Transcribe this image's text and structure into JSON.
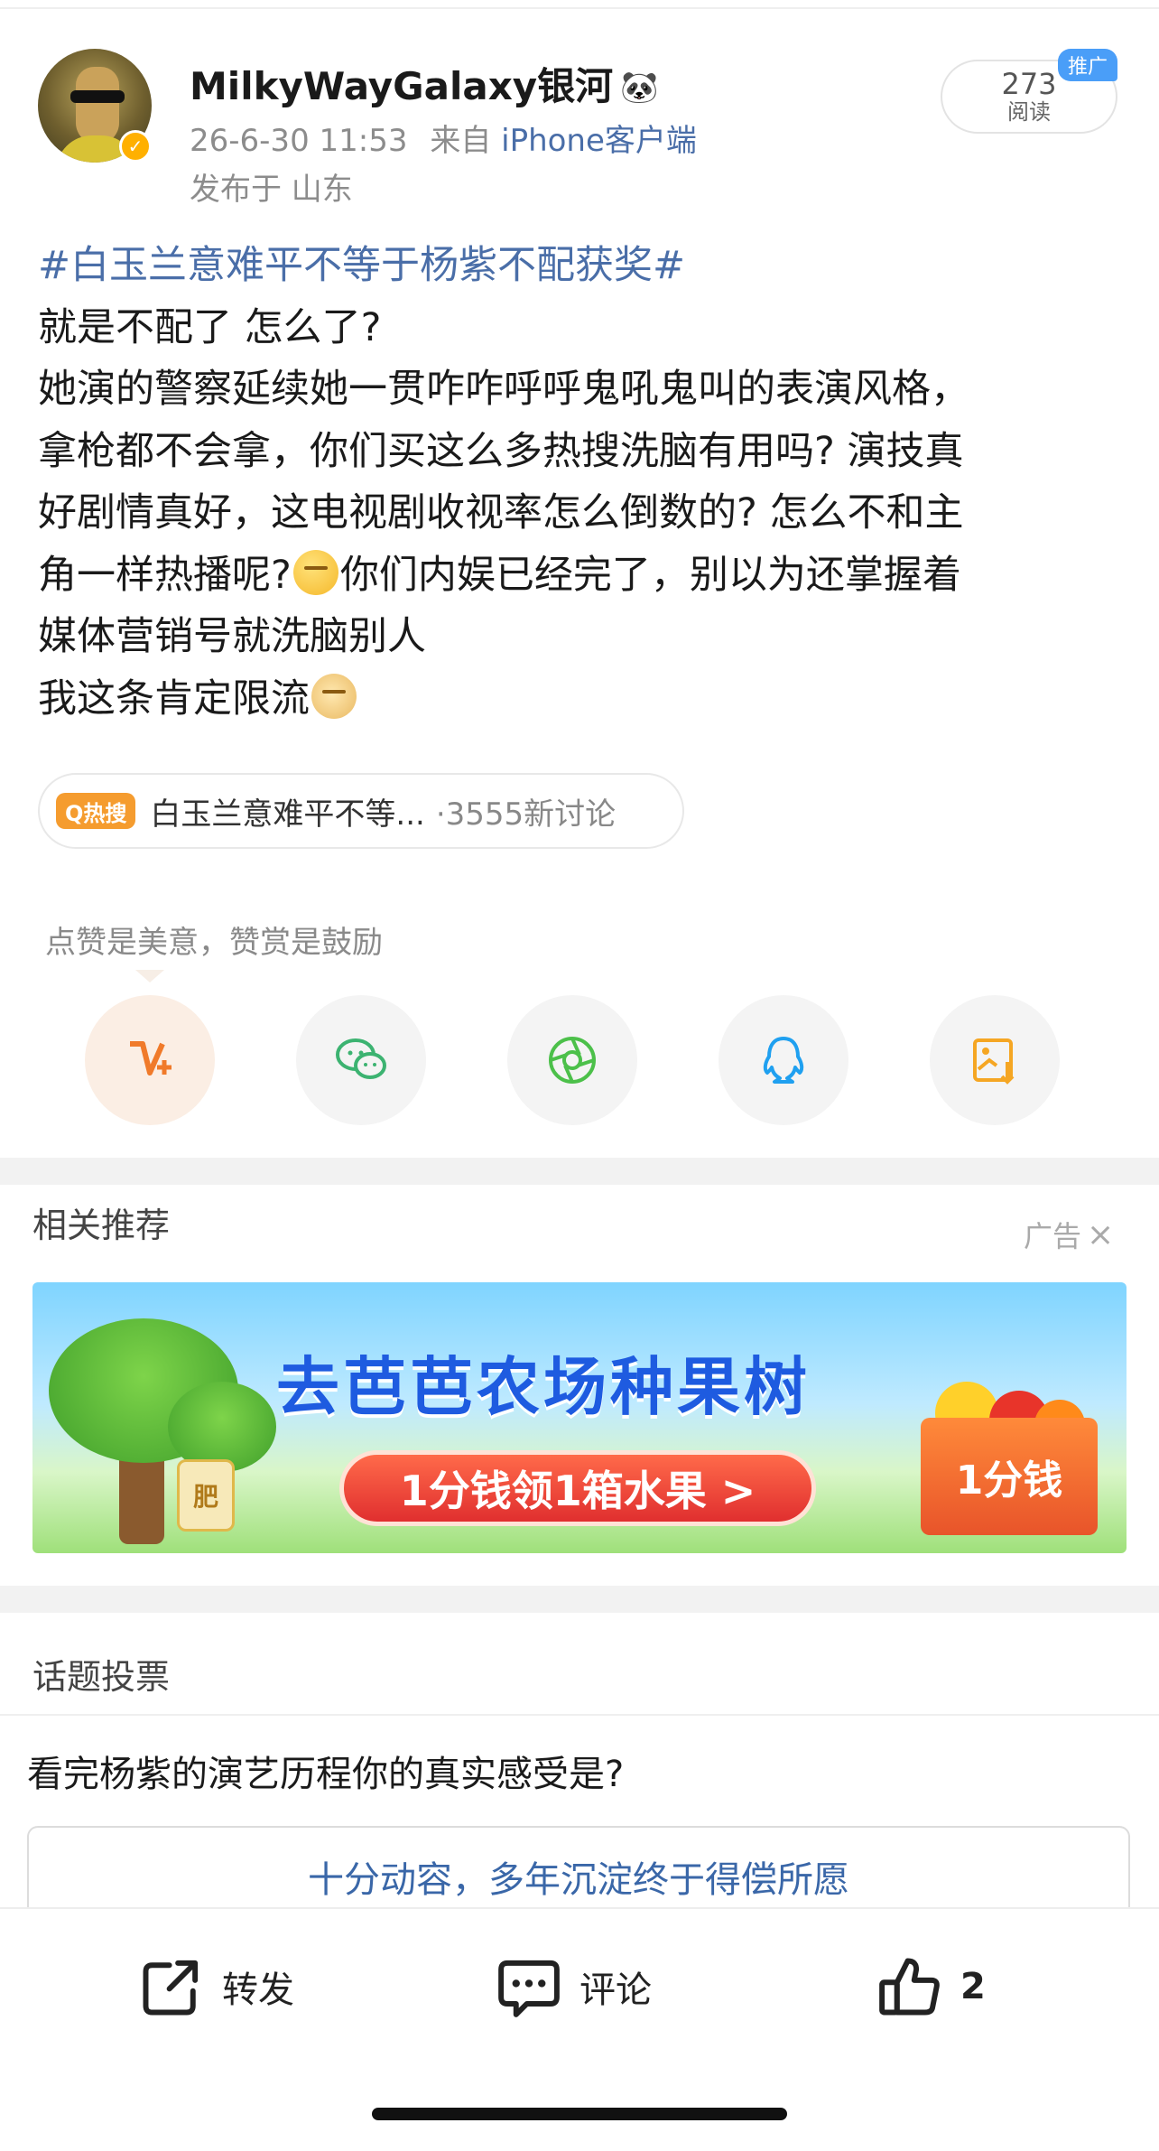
{
  "post": {
    "username": "MilkyWayGalaxy银河",
    "username_badge": "🐼",
    "timestamp": "26-6-30 11:53",
    "source_prefix": "来自",
    "source": "iPhone客户端",
    "location": "发布于 山东",
    "read_count": "273",
    "read_label": "阅读",
    "promo_badge": "推广",
    "verified_mark": "✓",
    "topic": "#白玉兰意难平不等于杨紫不配获奖#",
    "lines": [
      "就是不配了  怎么了?",
      "她演的警察延续她一贯咋咋呼呼鬼吼鬼叫的表演风格，",
      "拿枪都不会拿，你们买这么多热搜洗脑有用吗? 演技真",
      "好剧情真好，这电视剧收视率怎么倒数的? 怎么不和主",
      "角一样热播呢?",
      "你们内娱已经完了，别以为还掌握着",
      "媒体营销号就洗脑别人",
      "我这条肯定限流"
    ]
  },
  "hot_search": {
    "tag": "Q热搜",
    "text": "白玉兰意难平不等...",
    "count": "·3555新讨论"
  },
  "share": {
    "hint": "点赞是美意，赞赏是鼓励",
    "icons": [
      "weibo-v-icon",
      "wechat-icon",
      "moments-icon",
      "qq-icon",
      "save-image-icon"
    ]
  },
  "recommend": {
    "title": "相关推荐",
    "ad_label": "广告",
    "banner_title": "去芭芭农场种果树",
    "banner_button": "1分钱领1箱水果 >",
    "banner_box": "1分钱",
    "banner_fertilizer": "肥"
  },
  "vote": {
    "title": "话题投票",
    "question": "看完杨紫的演艺历程你的真实感受是?",
    "options": [
      "十分动容，多年沉淀终于得偿所愿"
    ]
  },
  "toolbar": {
    "repost": "转发",
    "comment": "评论",
    "like_count": "2"
  },
  "colors": {
    "link": "#4a6ea8",
    "hot_tag": "#f59c2f",
    "verified": "#ffb000",
    "promo": "#4a9ef8"
  }
}
